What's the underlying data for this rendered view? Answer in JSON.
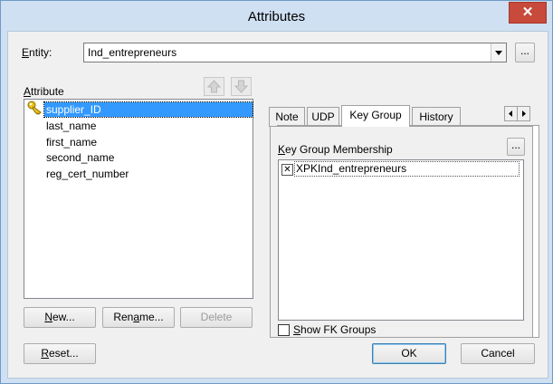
{
  "window": {
    "title": "Attributes",
    "close_glyph": "✕"
  },
  "entity": {
    "label": "Entity:",
    "label_underline": "E",
    "label_rest": "ntity:",
    "value": "Ind_entrepreneurs",
    "more_label": "..."
  },
  "attribute": {
    "label_underline": "A",
    "label_rest": "ttribute",
    "items": [
      "supplier_ID",
      "last_name",
      "first_name",
      "second_name",
      "reg_cert_number"
    ],
    "selected_index": 0
  },
  "buttons": {
    "new_u": "N",
    "new_rest": "ew...",
    "rename_a": "Ren",
    "rename_u": "a",
    "rename_b": "me...",
    "delete": "Delete",
    "reset_u": "R",
    "reset_rest": "eset...",
    "ok": "OK",
    "cancel": "Cancel"
  },
  "tabs": {
    "note": "Note",
    "udp": "UDP",
    "key_group": "Key Group",
    "history": "History",
    "active": "Key Group"
  },
  "key_group": {
    "label_underline": "K",
    "label_rest": "ey Group Membership",
    "more_label": "...",
    "members": [
      {
        "name": "XPKInd_entrepreneurs",
        "checked": true,
        "check_glyph": "✕"
      }
    ]
  },
  "show_fk": {
    "label_underline": "S",
    "label_rest": "how FK Groups",
    "checked": false
  },
  "colors": {
    "selection": "#3399ff",
    "title_bar": "#cfe0f3",
    "close_button": "#c74a3b"
  }
}
